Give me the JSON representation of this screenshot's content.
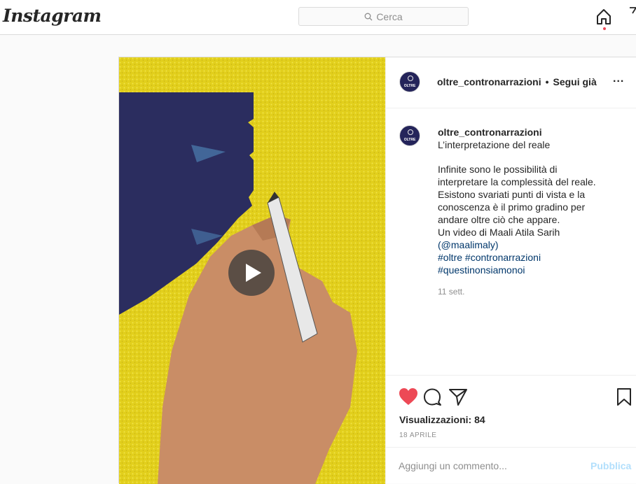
{
  "app": {
    "logo": "Instagram"
  },
  "search": {
    "placeholder": "Cerca"
  },
  "nav": {
    "home_icon": "home-icon",
    "notification_color": "#ed4956"
  },
  "post": {
    "username": "oltre_contronarrazioni",
    "separator": "•",
    "follow_status": "Segui già",
    "more": "...",
    "avatar_text": "OLTRE",
    "caption": {
      "username": "oltre_contronarrazioni",
      "title": "L’interpretazione del reale",
      "lines": [
        "Infinite sono le possibilità di",
        "interpretare la complessità del reale.",
        "Esistono svariati punti di vista e la",
        "conoscenza è il primo gradino per",
        "andare oltre ciò che appare.",
        "Un video di Maali Atila Sarih"
      ],
      "mention": "(@maalimaly)",
      "hashtags_line1": "#oltre #contronarrazioni",
      "hashtags_line2": "#questinonsiamonoi",
      "date": "11 sett."
    },
    "media": {
      "type": "video",
      "play_icon": "play-icon",
      "bg_color": "#e6d51e",
      "shape_color": "#2b2d5f"
    },
    "actions": {
      "liked": true,
      "like_color": "#ed4956",
      "views": "Visualizzazioni: 84",
      "date": "18 APRILE"
    },
    "comment": {
      "placeholder": "Aggiungi un commento...",
      "submit": "Pubblica"
    }
  }
}
